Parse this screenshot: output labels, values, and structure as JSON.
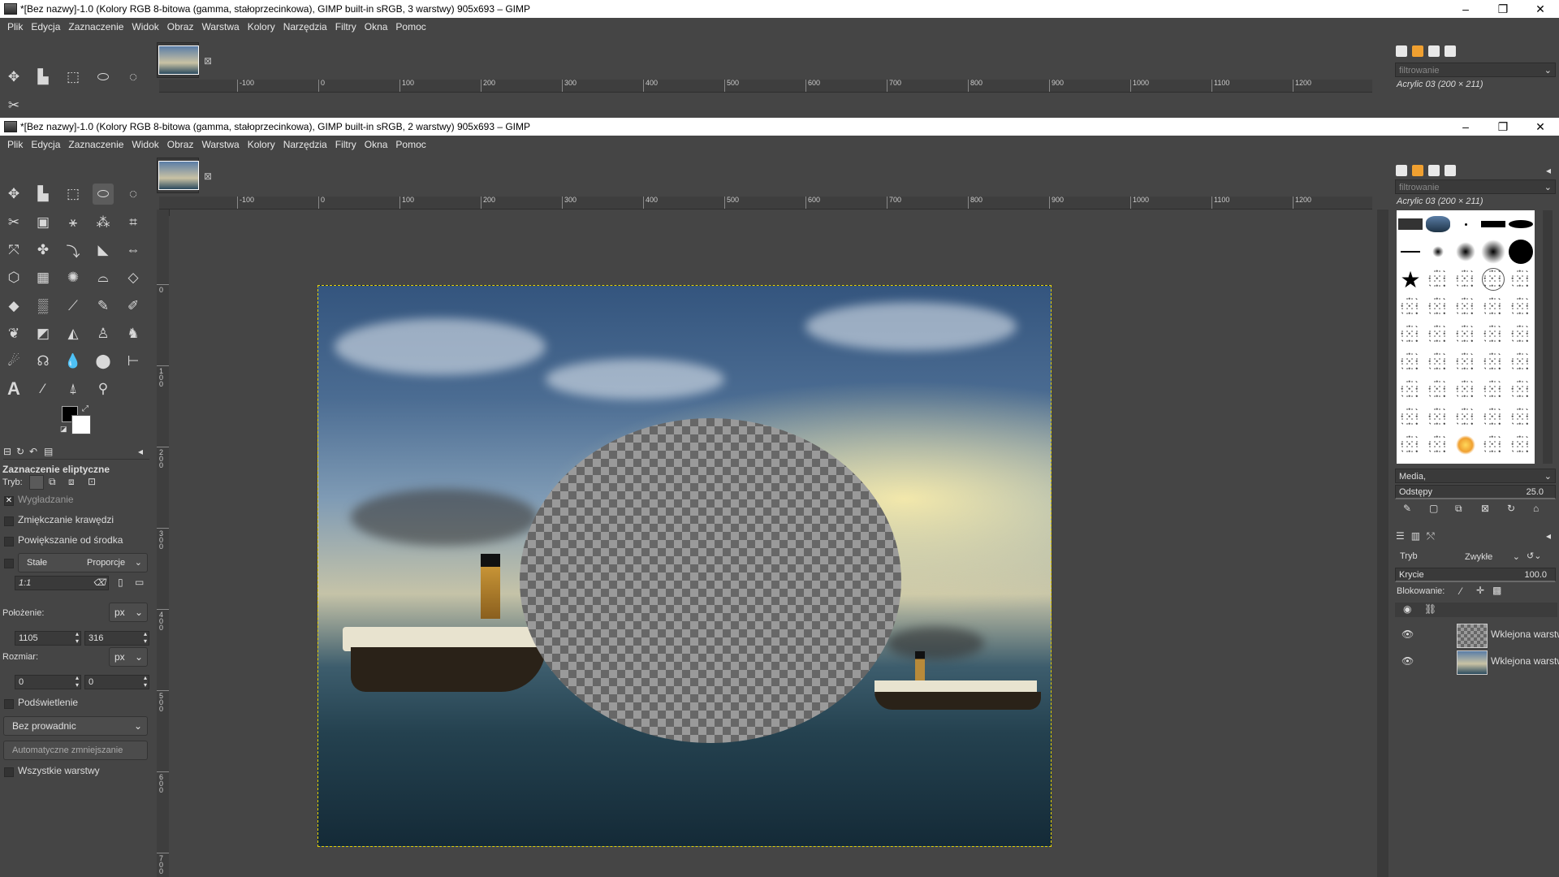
{
  "window_back": {
    "title": "*[Bez nazwy]-1.0 (Kolory RGB 8-bitowa (gamma, stałoprzecinkowa), GIMP built-in sRGB, 3 warstwy) 905x693 – GIMP",
    "controls": {
      "minimize": "–",
      "maximize": "❐",
      "close": "✕"
    }
  },
  "window_front": {
    "title": "*[Bez nazwy]-1.0 (Kolory RGB 8-bitowa (gamma, stałoprzecinkowa), GIMP built-in sRGB, 2 warstwy) 905x693 – GIMP",
    "controls": {
      "minimize": "–",
      "maximize": "❐",
      "close": "✕"
    }
  },
  "menu": [
    "Plik",
    "Edycja",
    "Zaznaczenie",
    "Widok",
    "Obraz",
    "Warstwa",
    "Kolory",
    "Narzędzia",
    "Filtry",
    "Okna",
    "Pomoc"
  ],
  "ruler": {
    "h_labels": [
      "-100",
      "0",
      "100",
      "200",
      "300",
      "400",
      "500",
      "600",
      "700",
      "800",
      "900",
      "1000",
      "1100",
      "1200"
    ],
    "v_labels": [
      "0",
      "100",
      "200",
      "300",
      "400",
      "500",
      "600",
      "700"
    ]
  },
  "tool_options": {
    "title": "Zaznaczenie eliptyczne",
    "mode_label": "Tryb:",
    "antialiasing": "Wygładzanie",
    "feather": "Zmiękczanie krawędzi",
    "expand_from_center": "Powiększanie od środka",
    "fixed": "Stałe",
    "fixed_mode": "Proporcje",
    "ratio": "1:1",
    "position_label": "Położenie:",
    "position_unit": "px",
    "position_x": "1105",
    "position_y": "316",
    "size_label": "Rozmiar:",
    "size_unit": "px",
    "size_w": "0",
    "size_h": "0",
    "highlight": "Podświetlenie",
    "guides": "Bez prowadnic",
    "auto_shrink": "Automatyczne zmniejszanie",
    "all_layers": "Wszystkie warstwy"
  },
  "brushes": {
    "filter_placeholder": "filtrowanie",
    "brush_name": "Acrylic 03 (200 × 211)",
    "tag": "Media,",
    "spacing_label": "Odstępy",
    "spacing_value": "25.0"
  },
  "layers": {
    "mode_label": "Tryb",
    "mode_value": "Zwykłe",
    "opacity_label": "Krycie",
    "opacity_value": "100.0",
    "lock_label": "Blokowanie:",
    "items": [
      {
        "name": "Wklejona warstwa"
      },
      {
        "name": "Wklejona warstwa"
      }
    ]
  },
  "colors": {
    "accent_selection": "#e8d200",
    "fg": "#000000",
    "bg": "#ffffff"
  }
}
